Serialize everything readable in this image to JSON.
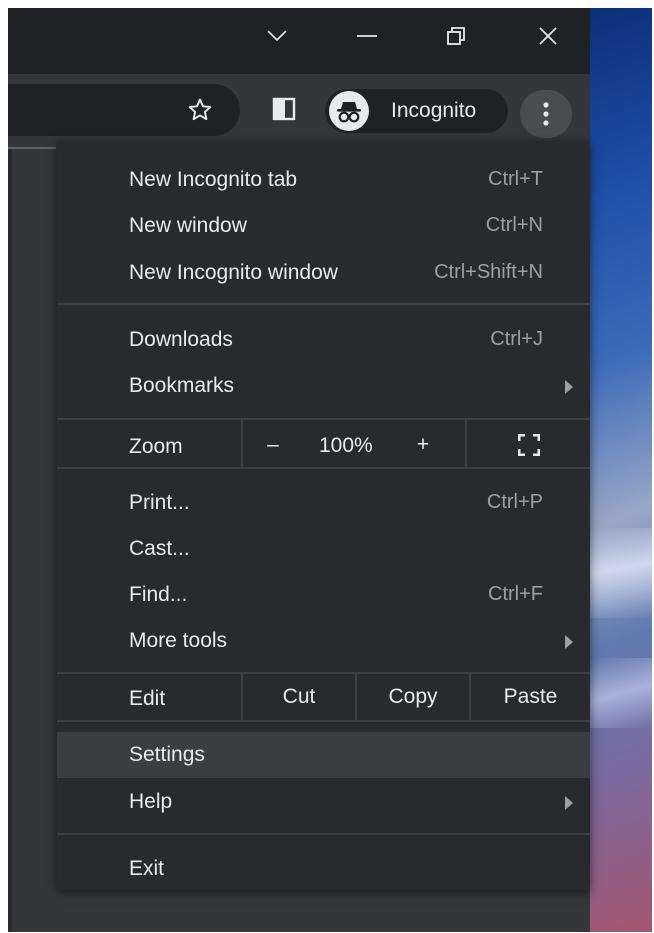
{
  "window_controls": {
    "tab_search": "chevron-down-icon",
    "minimize": "minimize-icon",
    "restore": "restore-icon",
    "close": "close-icon"
  },
  "toolbar": {
    "bookmark_star": "star-icon",
    "side_panel": "side-panel-icon",
    "profile_label": "Incognito",
    "menu_button": "kebab-icon"
  },
  "menu": {
    "new_tab": {
      "label": "New Incognito tab",
      "shortcut": "Ctrl+T"
    },
    "new_window": {
      "label": "New window",
      "shortcut": "Ctrl+N"
    },
    "new_incognito_window": {
      "label": "New Incognito window",
      "shortcut": "Ctrl+Shift+N"
    },
    "downloads": {
      "label": "Downloads",
      "shortcut": "Ctrl+J"
    },
    "bookmarks": {
      "label": "Bookmarks"
    },
    "zoom": {
      "label": "Zoom",
      "minus": "–",
      "value": "100%",
      "plus": "+"
    },
    "print": {
      "label": "Print...",
      "shortcut": "Ctrl+P"
    },
    "cast": {
      "label": "Cast..."
    },
    "find": {
      "label": "Find...",
      "shortcut": "Ctrl+F"
    },
    "more_tools": {
      "label": "More tools"
    },
    "edit": {
      "label": "Edit",
      "cut": "Cut",
      "copy": "Copy",
      "paste": "Paste"
    },
    "settings": {
      "label": "Settings"
    },
    "help": {
      "label": "Help"
    },
    "exit": {
      "label": "Exit"
    }
  },
  "colors": {
    "menu_bg": "#292a2d",
    "hover_bg": "#3c3d41",
    "text": "#e8eaed",
    "shortcut_text": "#9aa0a6",
    "titlebar": "#202124"
  }
}
